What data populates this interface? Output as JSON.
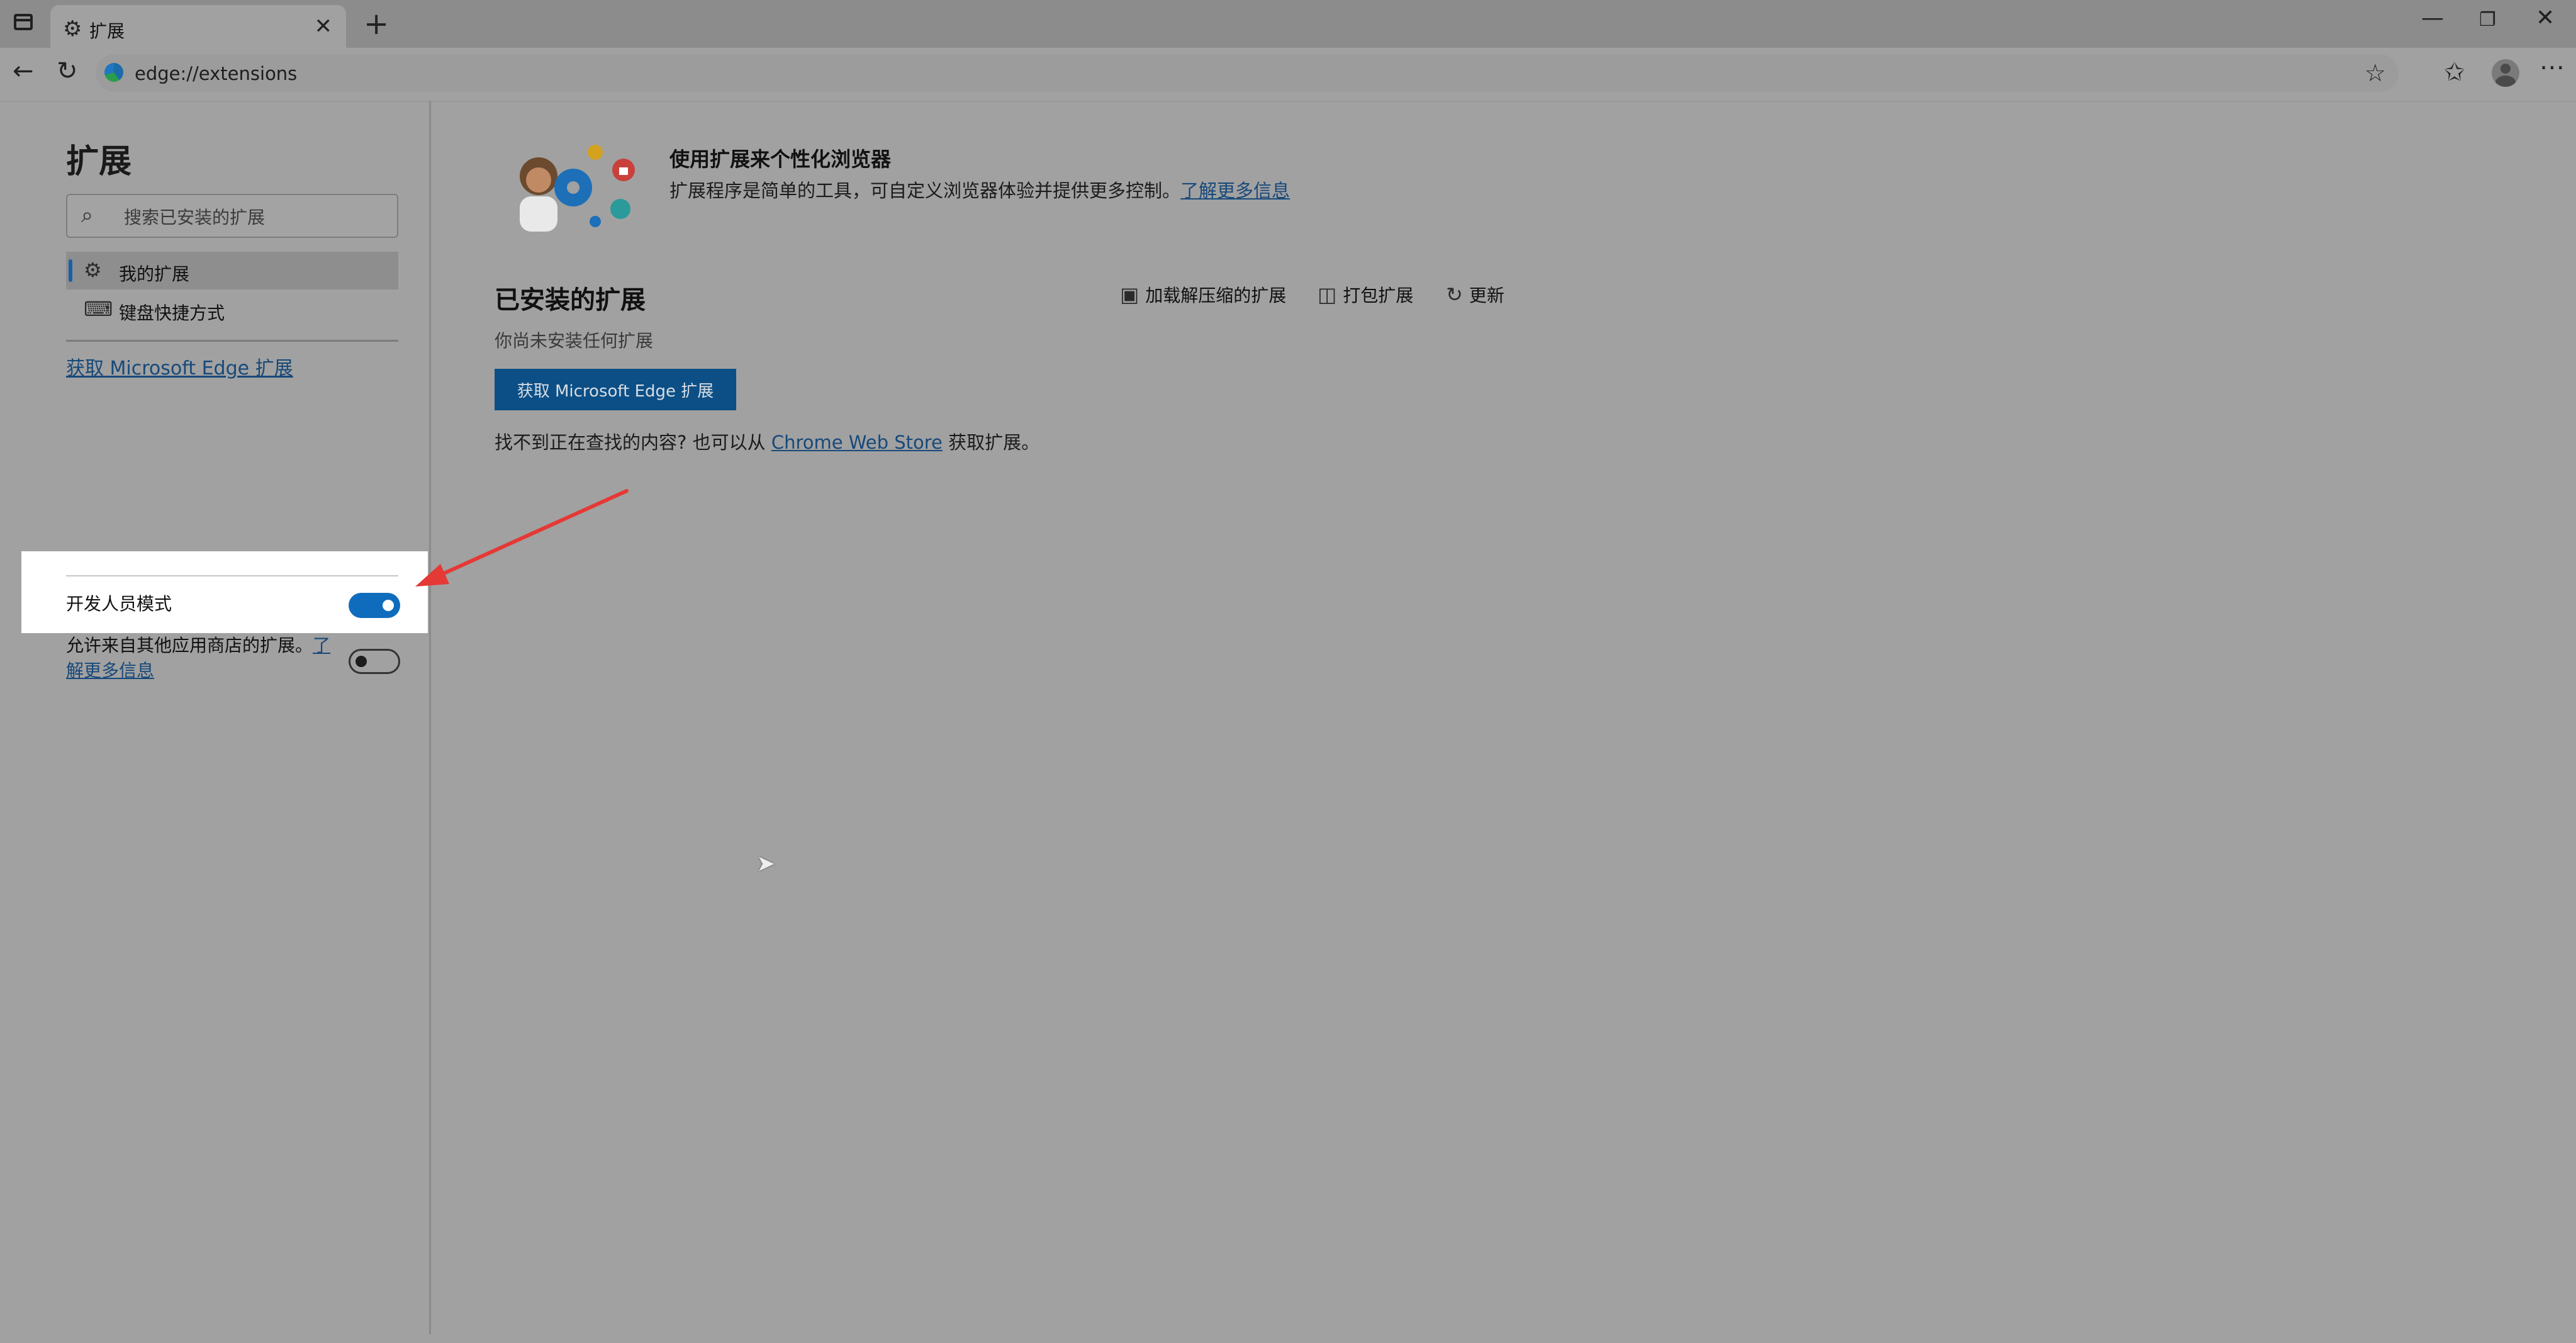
{
  "browser": {
    "tab_title": "扩展",
    "url": "edge://extensions"
  },
  "sidebar": {
    "title": "扩展",
    "search_placeholder": "搜索已安装的扩展",
    "items": [
      {
        "label": "我的扩展",
        "icon": "puzzle-icon",
        "active": true
      },
      {
        "label": "键盘快捷方式",
        "icon": "keyboard-icon",
        "active": false
      }
    ],
    "get_extensions_link": "获取 Microsoft Edge 扩展",
    "developer_mode_label": "开发人员模式",
    "developer_mode_on": true,
    "allow_other_stores_text": "允许来自其他应用商店的扩展。",
    "allow_other_stores_link": "了解更多信息",
    "allow_other_stores_on": false
  },
  "main": {
    "hero_title": "使用扩展来个性化浏览器",
    "hero_desc": "扩展程序是简单的工具，可自定义浏览器体验并提供更多控制。",
    "hero_link": "了解更多信息",
    "installed_title": "已安装的扩展",
    "actions": [
      {
        "label": "加载解压缩的扩展",
        "icon": "archive-icon"
      },
      {
        "label": "打包扩展",
        "icon": "package-icon"
      },
      {
        "label": "更新",
        "icon": "refresh-icon"
      }
    ],
    "empty_text": "你尚未安装任何扩展",
    "get_button": "获取 Microsoft Edge 扩展",
    "store_prefix": "找不到正在查找的内容? 也可以从",
    "store_link": "Chrome Web Store",
    "store_suffix": "获取扩展。"
  },
  "colors": {
    "accent": "#0f6cbd",
    "annotation_arrow": "#e53935",
    "overlay": "#a1a1a1"
  }
}
